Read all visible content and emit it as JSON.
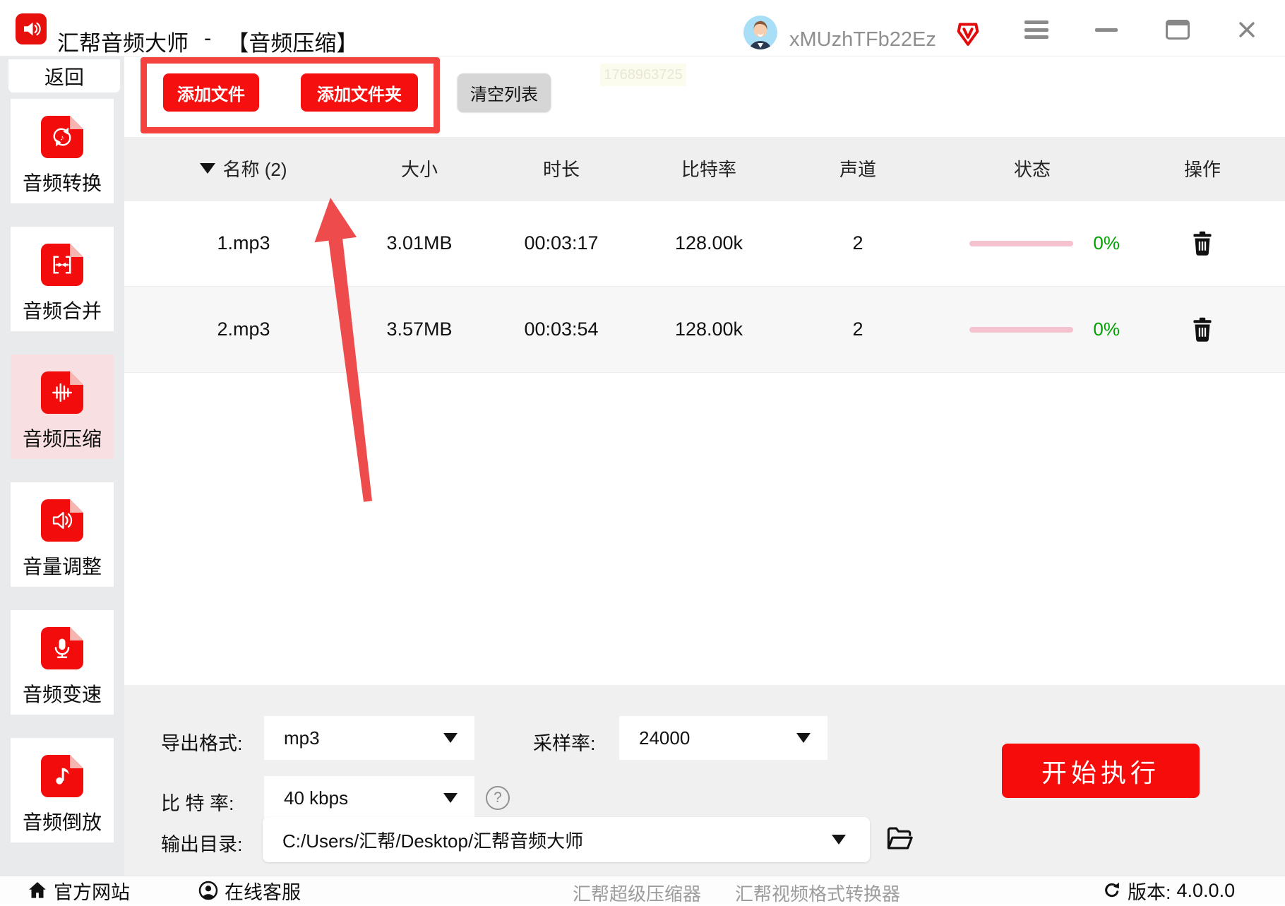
{
  "window": {
    "app_name": "汇帮音频大师",
    "separator": "-",
    "page_title": "【音频压缩】",
    "username": "xMUzhTFb22Ez"
  },
  "sidebar": {
    "back_label": "返回",
    "items": [
      {
        "label": "音频转换",
        "icon": "audio-convert",
        "selected": false
      },
      {
        "label": "音频合并",
        "icon": "audio-merge",
        "selected": false
      },
      {
        "label": "音频压缩",
        "icon": "audio-compress",
        "selected": true
      },
      {
        "label": "音量调整",
        "icon": "volume-adjust",
        "selected": false
      },
      {
        "label": "音频变速",
        "icon": "audio-speed",
        "selected": false
      },
      {
        "label": "音频倒放",
        "icon": "audio-reverse",
        "selected": false
      }
    ]
  },
  "toolbar": {
    "add_file": "添加文件",
    "add_folder": "添加文件夹",
    "clear_list": "清空列表",
    "watermark": "1768963725"
  },
  "table": {
    "headers": {
      "name": "名称 (2)",
      "size": "大小",
      "duration": "时长",
      "bitrate": "比特率",
      "channels": "声道",
      "status": "状态",
      "action": "操作"
    },
    "rows": [
      {
        "name": "1.mp3",
        "size": "3.01MB",
        "duration": "00:03:17",
        "bitrate": "128.00k",
        "channels": "2",
        "progress": "0%"
      },
      {
        "name": "2.mp3",
        "size": "3.57MB",
        "duration": "00:03:54",
        "bitrate": "128.00k",
        "channels": "2",
        "progress": "0%"
      }
    ]
  },
  "settings": {
    "export_format_label": "导出格式:",
    "export_format_value": "mp3",
    "sample_rate_label": "采样率:",
    "sample_rate_value": "24000",
    "bitrate_label": "比 特 率:",
    "bitrate_value": "40 kbps",
    "help_glyph": "?",
    "output_dir_label": "输出目录:",
    "output_dir_value": "C:/Users/汇帮/Desktop/汇帮音频大师",
    "start_button": "开始执行"
  },
  "footer": {
    "official_site": "官方网站",
    "online_service": "在线客服",
    "link_compressor": "汇帮超级压缩器",
    "link_video_converter": "汇帮视频格式转换器",
    "version_label": "版本:",
    "version_value": "4.0.0.0"
  },
  "colors": {
    "brand_red": "#f20c0c",
    "annotation_red": "#f4423e",
    "arrow_red": "#ee4c4c",
    "selected_pink": "#f8dfe1",
    "progress_pink": "#f5c2d0",
    "progress_green": "#00a000",
    "header_gray": "#efefef"
  }
}
